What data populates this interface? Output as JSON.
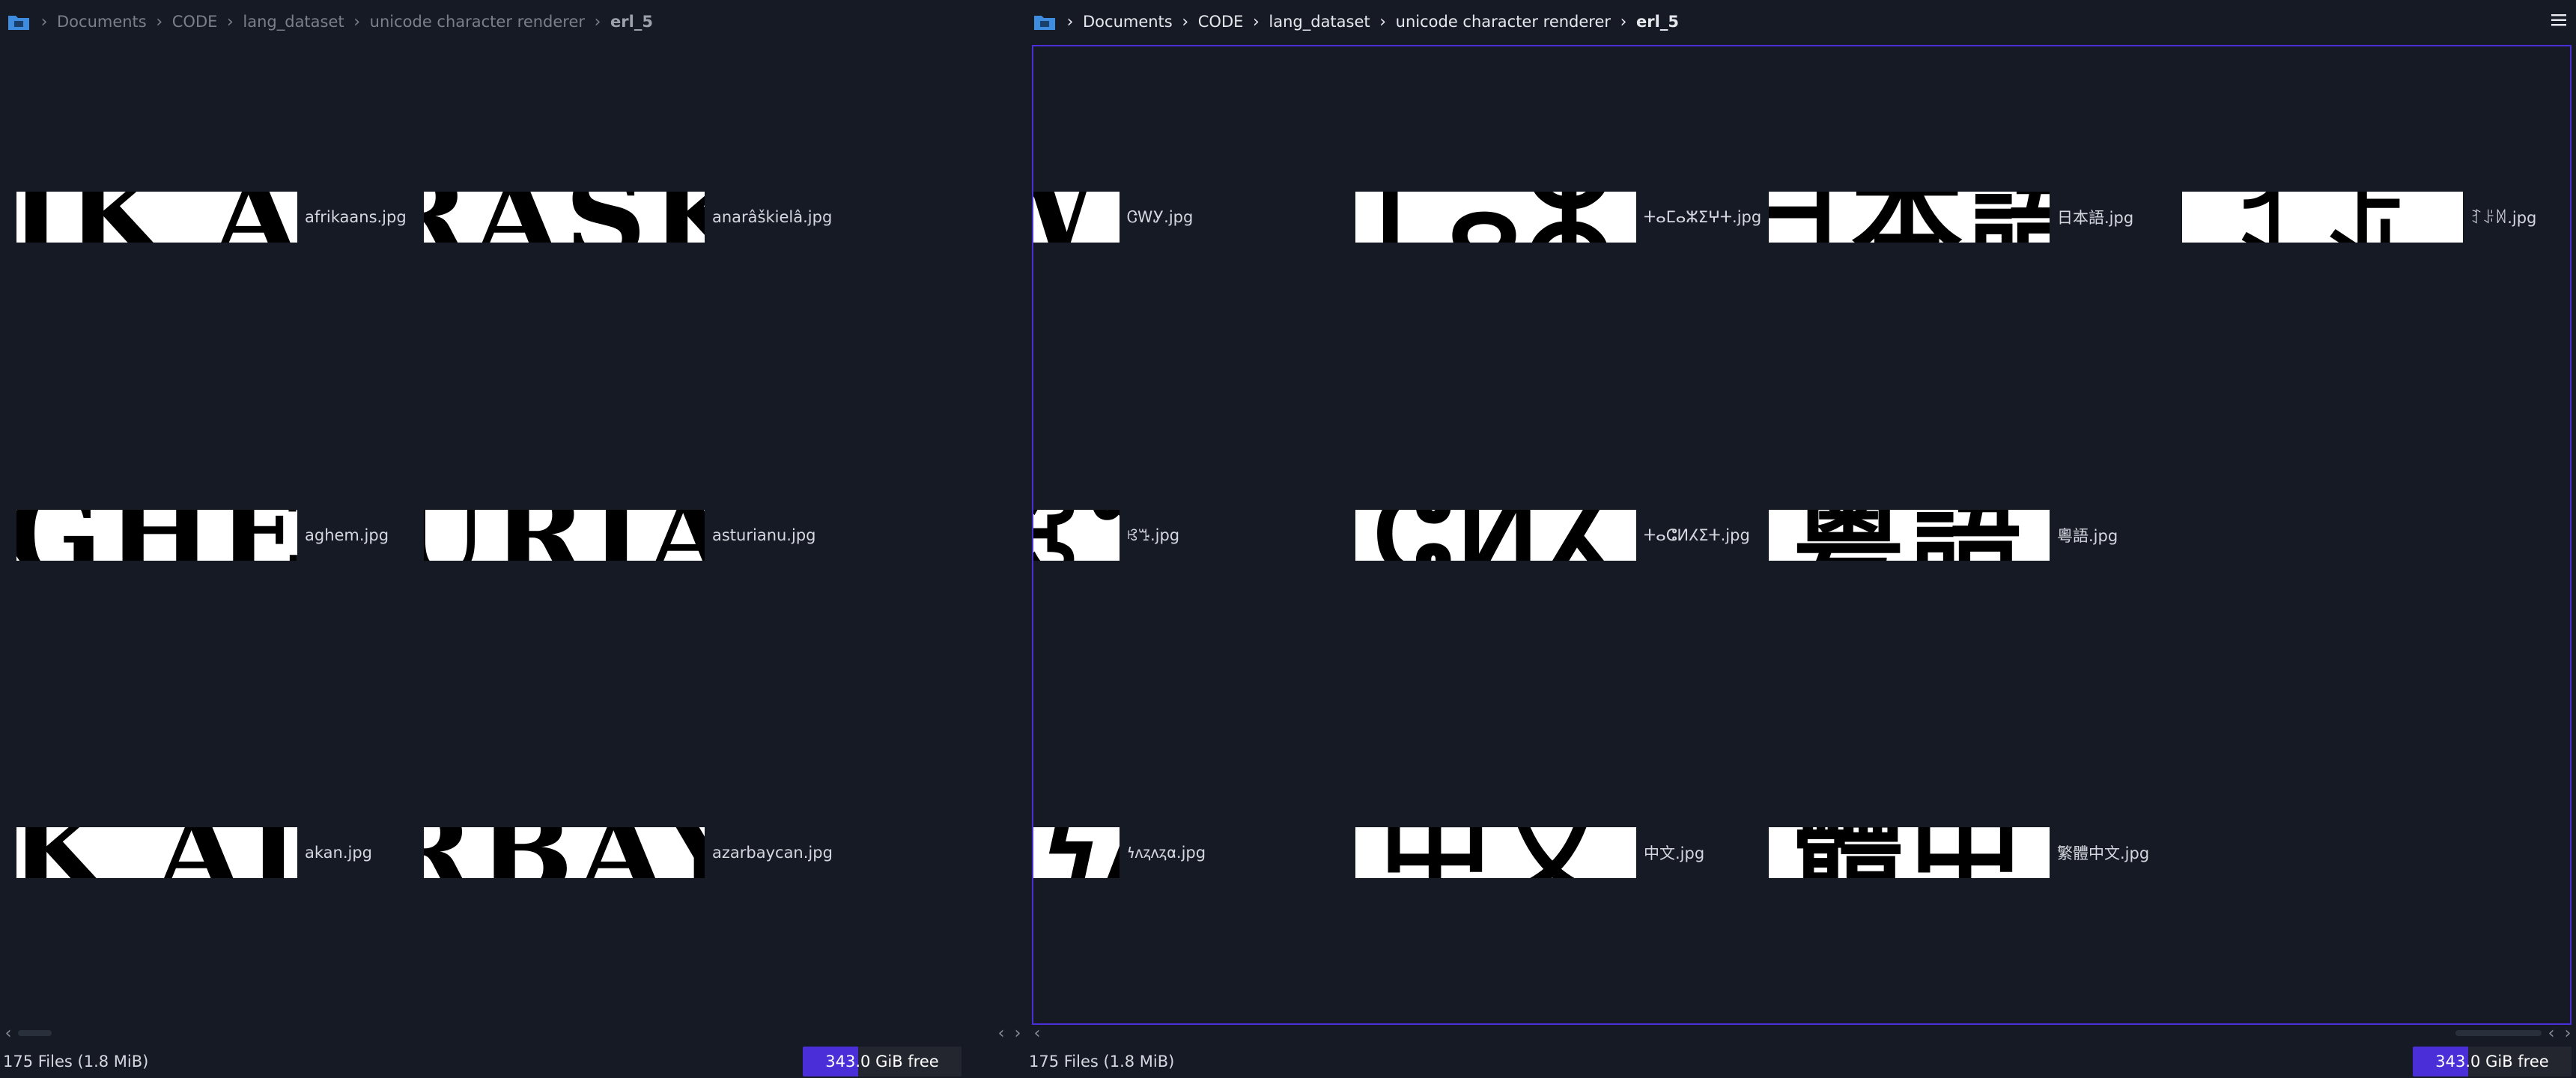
{
  "left_pane": {
    "breadcrumb": [
      "Documents",
      "CODE",
      "lang_dataset",
      "unicode character renderer",
      "erl_5"
    ],
    "files": [
      {
        "name": "afrikaans.jpg",
        "thumb": "IK A"
      },
      {
        "name": "anarâškielâ.jpg",
        "thumb": "RASK"
      },
      {
        "name": "aghem.jpg",
        "thumb": "GHE"
      },
      {
        "name": "asturianu.jpg",
        "thumb": "URIA"
      },
      {
        "name": "akan.jpg",
        "thumb": "K AI"
      },
      {
        "name": "azarbaycan.jpg",
        "thumb": "RBAY"
      }
    ],
    "status": {
      "count": "175 Files (1.8 MiB)",
      "free": "343.0 GiB free",
      "used_fraction": 0.35
    }
  },
  "right_pane": {
    "breadcrumb": [
      "Documents",
      "CODE",
      "lang_dataset",
      "unicode character renderer",
      "erl_5"
    ],
    "files": [
      {
        "name": "ᏣᎳᎩ.jpg",
        "thumb": "A NW Y"
      },
      {
        "name": "ⵜⴰⵎⴰⵣⵉⵖⵜ.jpg",
        "thumb": "ⵎⴰⵣ"
      },
      {
        "name": "日本語.jpg",
        "thumb": "日本語"
      },
      {
        "name": "ꆈꌠꉙ.jpg",
        "thumb": "ꆈꌠ"
      },
      {
        "name": "ꕙꔤ.jpg",
        "thumb": "A Sꕙꔤ"
      },
      {
        "name": "ⵜⴰⵛⵍⵃⵉⵜ.jpg",
        "thumb": "ⵛⵍⵃ"
      },
      {
        "name": "粵語.jpg",
        "thumb": "粵語"
      },
      {
        "name": "𐓏𐓘𐓻𐓘𐓻𐓟.jpg",
        "thumb": "NIS𐓏𐓘"
      },
      {
        "name": "中文.jpg",
        "thumb": "中文"
      },
      {
        "name": "繁體中文.jpg",
        "thumb": "體中"
      }
    ],
    "status": {
      "count": "175 Files (1.8 MiB)",
      "free": "343.0 GiB free",
      "used_fraction": 0.35
    }
  },
  "icons": {
    "folder": "folder-icon",
    "chevron": "chevron-right-icon",
    "menu": "hamburger-menu-icon"
  },
  "colors": {
    "accent": "#4a2fd8",
    "background": "#161a24",
    "folder": "#3d8ce0"
  }
}
